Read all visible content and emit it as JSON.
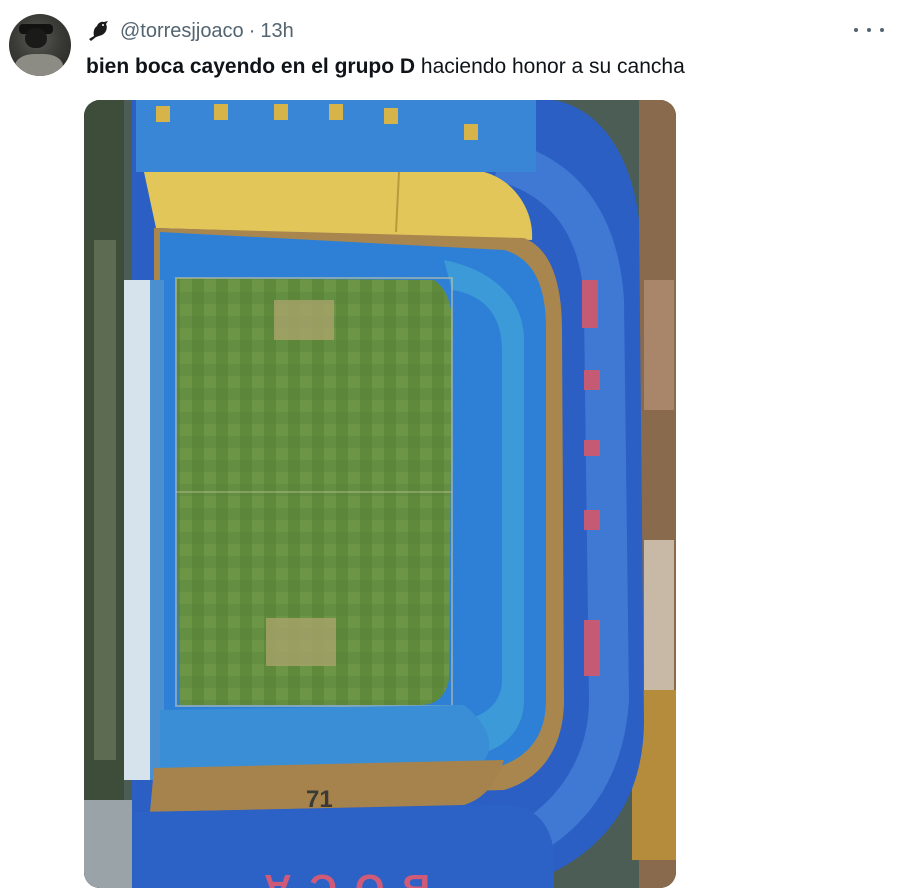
{
  "tweet": {
    "author_handle": "@torresjjoaco",
    "separator": "·",
    "time": "13h",
    "text_bold": "bien boca cayendo en el grupo D",
    "text_regular": " haciendo honor a su cancha",
    "header_icon": "bird-icon",
    "more_icon": "more-options-icon"
  },
  "media": {
    "description_icon": "stadium-aerial-photo",
    "stand_lettering": "BOCA",
    "stand_number": "71"
  },
  "colors": {
    "secondary_text": "#536471",
    "primary_text": "#0f1419",
    "stadium_blue": "#2f63c9",
    "stadium_yellow": "#e2c65a",
    "pitch_green": "#5f8a3c"
  }
}
